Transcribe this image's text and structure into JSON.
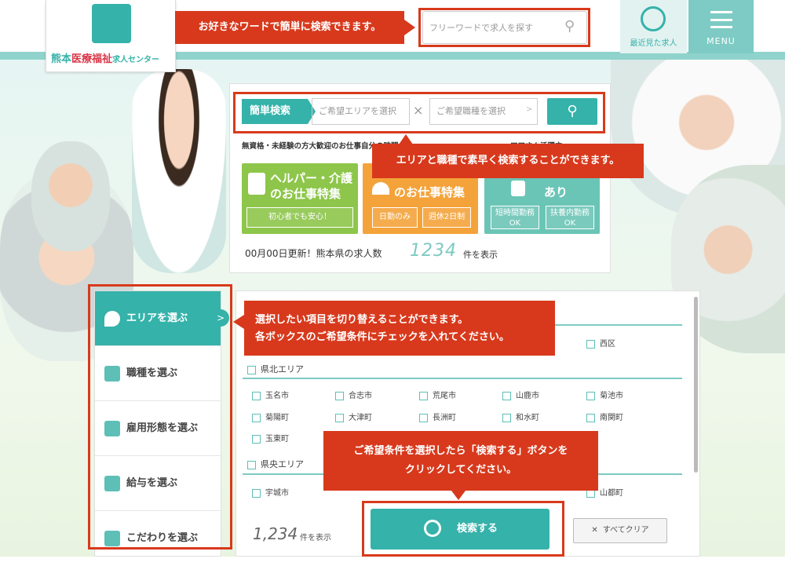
{
  "header": {
    "logo": {
      "part1": "熊本",
      "part2": "医療福祉",
      "part3": "求人センター"
    },
    "search_placeholder": "フリーワードで求人を探す",
    "recent_label": "最近見た求人",
    "menu_label": "MENU"
  },
  "quick_search": {
    "label": "簡単検索",
    "area_placeholder": "ご希望エリアを選択",
    "job_placeholder": "ご希望職種を選択"
  },
  "features": [
    {
      "caption": "無資格・未経験の方大歓迎のお仕事",
      "title_line1": "ヘルパー・介護",
      "title_line2": "のお仕事特集",
      "tags": [
        "初心者でも安心！"
      ]
    },
    {
      "caption": "自分の時間",
      "title_line1": "",
      "title_line2": "のお仕事特集",
      "tags": [
        "日勤のみ",
        "週休2日制"
      ]
    },
    {
      "caption": "アアさん活躍中",
      "title_line1": "",
      "title_line2": "あり",
      "tags": [
        "短時間勤務OK",
        "扶養内勤務OK"
      ]
    }
  ],
  "update": {
    "text": "00月00日更新！熊本県の求人数",
    "count": "1234",
    "unit": "件を表示"
  },
  "sidebar": {
    "items": [
      {
        "label": "エリアを選ぶ",
        "icon": "map-pin-icon"
      },
      {
        "label": "職種を選ぶ",
        "icon": "stack-icon"
      },
      {
        "label": "雇用形態を選ぶ",
        "icon": "person-icon"
      },
      {
        "label": "給与を選ぶ",
        "icon": "money-icon"
      },
      {
        "label": "こだわりを選ぶ",
        "icon": "clipboard-icon"
      }
    ]
  },
  "list": {
    "top_city": "西区",
    "regions": [
      {
        "name": "県北エリア",
        "cities": [
          "玉名市",
          "合志市",
          "荒尾市",
          "山鹿市",
          "菊池市",
          "菊陽町",
          "大津町",
          "長洲町",
          "和水町",
          "南関町",
          "玉東町"
        ]
      },
      {
        "name": "県央エリア",
        "cities": [
          "宇城市",
          "",
          "",
          "",
          "山都町"
        ]
      }
    ]
  },
  "actions": {
    "count": "1,234",
    "unit": "件を表示",
    "search": "検索する",
    "clear": "すべてクリア"
  },
  "annotations": {
    "top": "お好きなワードで簡単に検索できます。",
    "quick": "エリアと職種で素早く検索することができます。",
    "side_line1": "選択したい項目を切り替えることができます。",
    "side_line2": "各ボックスのご希望条件にチェックを入れてください。",
    "btn_line1": "ご希望条件を選択したら「検索する」ボタンを",
    "btn_line2": "クリックしてください。"
  },
  "colors": {
    "teal": "#35b2aa",
    "annotation": "#d8391c",
    "green": "#8dc64a",
    "orange": "#f4a33a"
  }
}
